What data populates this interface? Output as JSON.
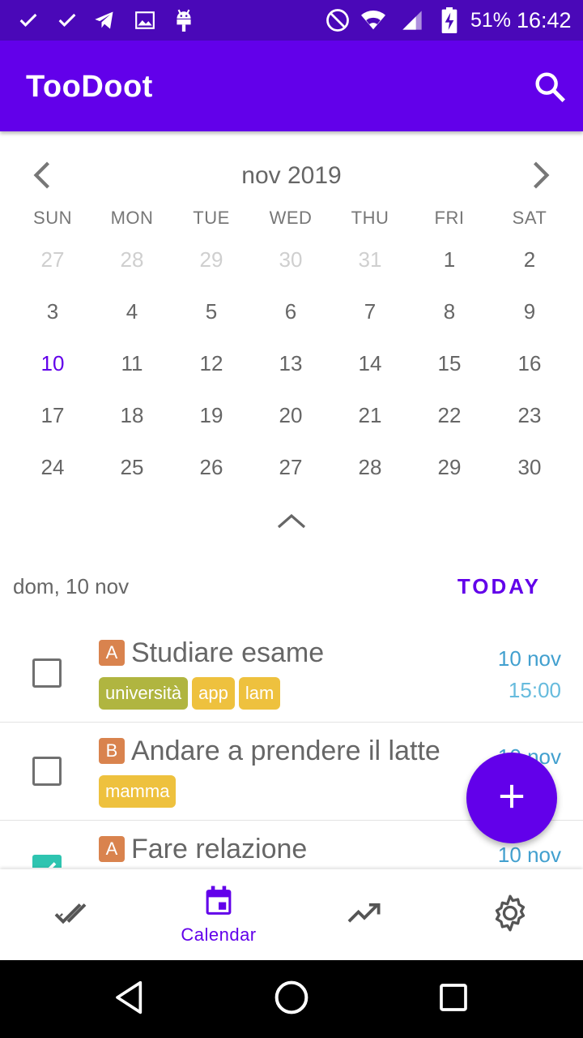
{
  "status_bar": {
    "battery": "51%",
    "time": "16:42",
    "left_icons": [
      "check-icon",
      "check-icon",
      "telegram-icon",
      "image-icon",
      "android-icon"
    ],
    "right_icons": [
      "do-not-disturb-icon",
      "wifi-icon",
      "signal-icon",
      "battery-charging-icon"
    ]
  },
  "app_bar": {
    "title": "TooDoot",
    "search_icon": "search-icon"
  },
  "calendar": {
    "month_label": "nov 2019",
    "weekdays": [
      "SUN",
      "MON",
      "TUE",
      "WED",
      "THU",
      "FRI",
      "SAT"
    ],
    "weeks": [
      [
        "27",
        "28",
        "29",
        "30",
        "31",
        "1",
        "2"
      ],
      [
        "3",
        "4",
        "5",
        "6",
        "7",
        "8",
        "9"
      ],
      [
        "10",
        "11",
        "12",
        "13",
        "14",
        "15",
        "16"
      ],
      [
        "17",
        "18",
        "19",
        "20",
        "21",
        "22",
        "23"
      ],
      [
        "24",
        "25",
        "26",
        "27",
        "28",
        "29",
        "30"
      ]
    ],
    "outside_month_days": [
      "27",
      "28",
      "29",
      "30",
      "31"
    ],
    "selected_day": "10",
    "selected_date_label": "dom, 10 nov",
    "today_button": "TODAY"
  },
  "tasks": [
    {
      "priority": "A",
      "title": "Studiare esame",
      "tags": [
        {
          "label": "università",
          "color": "#b0b540"
        },
        {
          "label": "app",
          "color": "#eec13e"
        },
        {
          "label": "lam",
          "color": "#eec13e"
        }
      ],
      "date": "10 nov",
      "time": "15:00",
      "checked": false
    },
    {
      "priority": "B",
      "title": "Andare a prendere il latte",
      "tags": [
        {
          "label": "mamma",
          "color": "#eec13e"
        }
      ],
      "date": "10 nov",
      "time": "",
      "checked": false
    },
    {
      "priority": "A",
      "title": "Fare relazione",
      "tags": [],
      "date": "10 nov",
      "time": "",
      "checked": true
    }
  ],
  "fab": {
    "icon": "plus-icon"
  },
  "bottom_nav": {
    "items": [
      {
        "icon": "done-all-icon",
        "label": ""
      },
      {
        "icon": "calendar-icon",
        "label": "Calendar",
        "active": true
      },
      {
        "icon": "trending-up-icon",
        "label": ""
      },
      {
        "icon": "gear-icon",
        "label": ""
      }
    ]
  },
  "system_nav": [
    "back-icon",
    "home-icon",
    "recents-icon"
  ],
  "colors": {
    "primary": "#6200ea",
    "status_bar": "#4a08b8",
    "priority_badge": "#d9834e",
    "checkbox_checked": "#2ec4b0",
    "date_text": "#42a0cf"
  }
}
